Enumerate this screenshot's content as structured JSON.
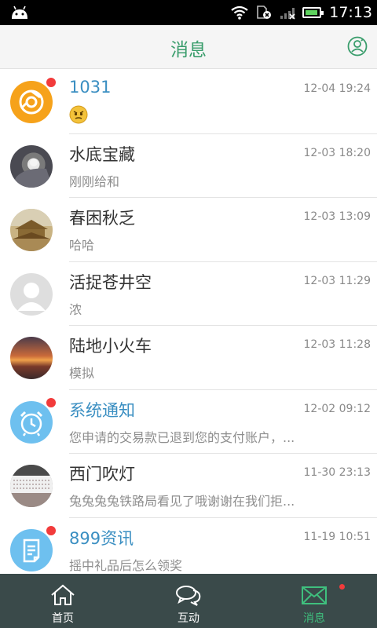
{
  "status_bar": {
    "time": "17:13",
    "battery_level": 0.9,
    "icons": [
      "android-icon",
      "wifi-icon",
      "sim-error-icon",
      "signal-icon",
      "battery-icon"
    ]
  },
  "header": {
    "title": "消息",
    "contact_icon": "contacts-icon"
  },
  "conversations": [
    {
      "name": "1031",
      "time": "12-04 19:24",
      "preview": "",
      "preview_emoji": "emoji-icon",
      "official": true,
      "unread": true,
      "avatar": "browser-icon"
    },
    {
      "name": "水底宝藏",
      "time": "12-03 18:20",
      "preview": "刚刚给和",
      "official": false,
      "unread": false,
      "avatar": "photo-avatar"
    },
    {
      "name": "春困秋乏",
      "time": "12-03 13:09",
      "preview": "哈哈",
      "official": false,
      "unread": false,
      "avatar": "photo-avatar"
    },
    {
      "name": "活捉苍井空",
      "time": "12-03 11:29",
      "preview": "浓",
      "official": false,
      "unread": false,
      "avatar": "default-avatar"
    },
    {
      "name": "陆地小火车",
      "time": "12-03 11:28",
      "preview": "模拟",
      "official": false,
      "unread": false,
      "avatar": "photo-avatar"
    },
    {
      "name": "系统通知",
      "time": "12-02 09:12",
      "preview": "您申请的交易款已退到您的支付账户，...",
      "official": true,
      "unread": true,
      "avatar": "alarm-clock-icon"
    },
    {
      "name": "西门吹灯",
      "time": "11-30 23:13",
      "preview": "兔兔兔兔铁路局看见了哦谢谢在我们拒...",
      "official": false,
      "unread": false,
      "avatar": "photo-avatar"
    },
    {
      "name": "899资讯",
      "time": "11-19 10:51",
      "preview": "摇中礼品后怎么领奖",
      "official": true,
      "unread": true,
      "avatar": "document-icon"
    }
  ],
  "bottom_nav": {
    "items": [
      {
        "label": "首页",
        "icon": "home-icon",
        "active": false
      },
      {
        "label": "互动",
        "icon": "chat-bubbles-icon",
        "active": false
      },
      {
        "label": "消息",
        "icon": "envelope-icon",
        "active": true,
        "dot": true
      }
    ]
  },
  "colors": {
    "accent_green": "#3a9d6c",
    "official_blue": "#3b8fc2",
    "badge_red": "#f23b3b",
    "nav_bg": "#3a4a4a"
  }
}
